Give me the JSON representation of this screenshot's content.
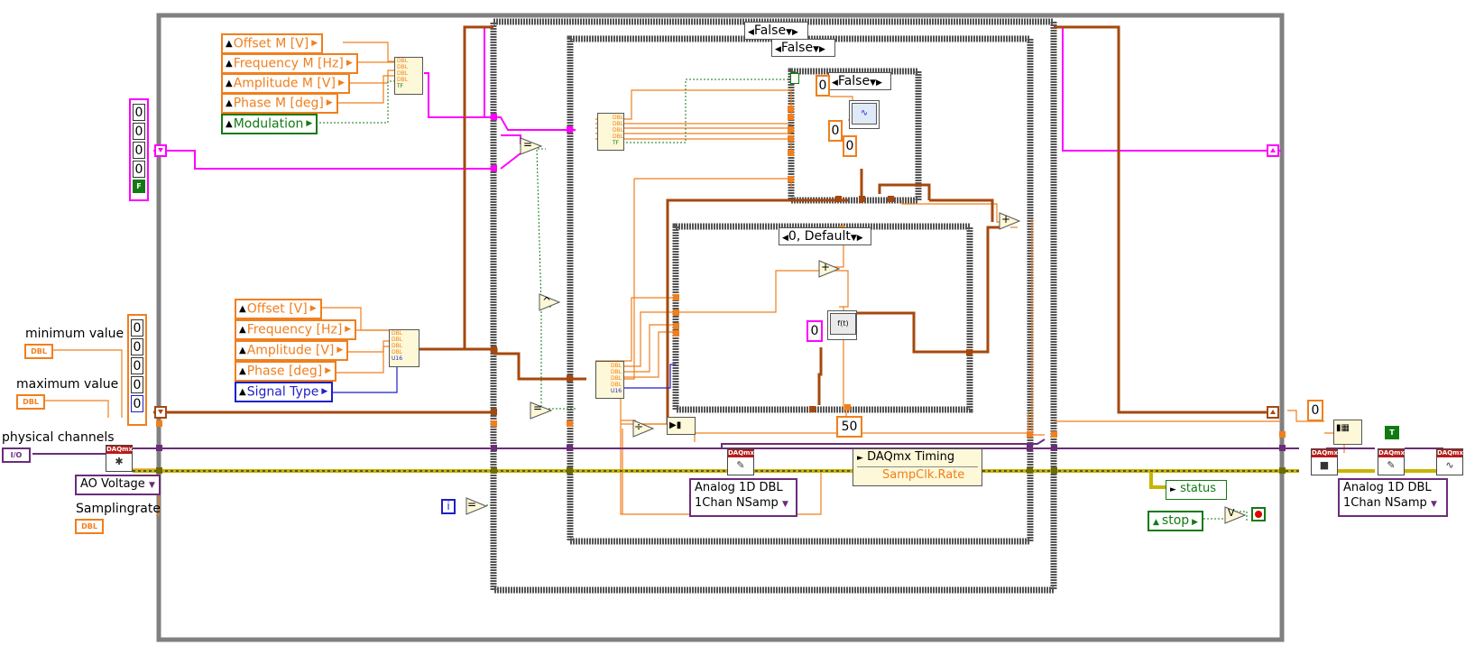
{
  "controls_m": {
    "offset": "Offset M [V]",
    "frequency": "Frequency M [Hz]",
    "amplitude": "Amplitude M [V]",
    "phase": "Phase M [deg]",
    "modulation": "Modulation"
  },
  "controls": {
    "offset": "Offset [V]",
    "frequency": "Frequency [Hz]",
    "amplitude": "Amplitude [V]",
    "phase": "Phase [deg]",
    "signal_type": "Signal Type"
  },
  "labels": {
    "minimum_value": "minimum value",
    "maximum_value": "maximum value",
    "physical_channels": "physical channels",
    "samplingrate": "Samplingrate"
  },
  "terminals": {
    "dbl": "DBL",
    "io": "I/O",
    "true_const": "T",
    "false_const": "F",
    "iteration": "i",
    "daqmx": "DAQmx"
  },
  "case_selectors": {
    "outer": "False",
    "middle": "False",
    "inner": "False",
    "signal": "0, Default"
  },
  "constants": {
    "zero": "0",
    "fifty": "50"
  },
  "left_arrays": {
    "pink_values": [
      "0",
      "0",
      "0",
      "0"
    ],
    "orange_values": [
      "0",
      "0",
      "0",
      "0",
      "0"
    ]
  },
  "ao_voltage": "AO Voltage",
  "timing": {
    "title": "DAQmx Timing",
    "property": "SampClk.Rate"
  },
  "write_mode": {
    "line1": "Analog 1D DBL",
    "line2": "1Chan NSamp"
  },
  "status_label": "status",
  "stop_label": "stop",
  "cluster_types": [
    "DBL",
    "DBL",
    "DBL",
    "DBL",
    "TF"
  ],
  "cluster_types2": [
    "DBL",
    "DBL",
    "DBL",
    "DBL",
    "U16"
  ],
  "function_labels": {
    "waveform": "f(t)",
    "plus": "+",
    "divide": "÷",
    "equal": "=",
    "and": "^",
    "or": "V"
  },
  "colors": {
    "orange_wire": "#f07f1d",
    "pink_wire": "#ff00ff",
    "purple_wire": "#6b2c7a",
    "green_wire": "#127a12",
    "error_wire": "#c8b400",
    "blue_wire": "#1f1fc8",
    "frame": "#808080"
  }
}
